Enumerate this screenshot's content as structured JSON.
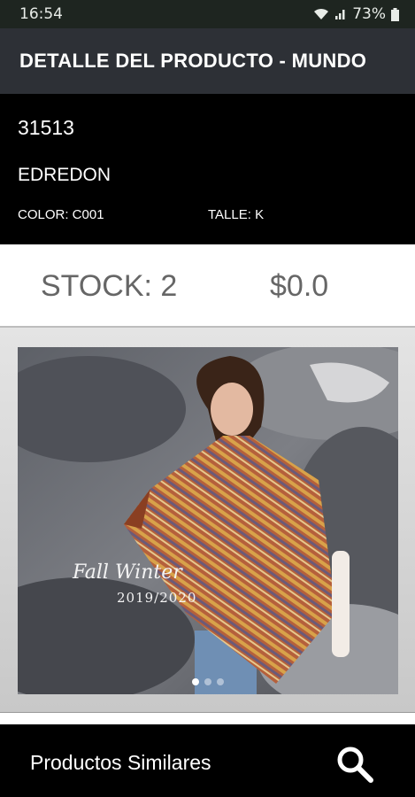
{
  "status_bar": {
    "time": "16:54",
    "battery": "73%",
    "icons": [
      "wifi-icon",
      "signal-icon",
      "battery-icon"
    ]
  },
  "app_bar": {
    "title": "DETALLE DEL PRODUCTO - MUNDO"
  },
  "product": {
    "code": "31513",
    "name": "EDREDON",
    "color": "COLOR: C001",
    "size": "TALLE: K",
    "stock": "STOCK: 2",
    "price": "$0.0"
  },
  "gallery": {
    "caption_line1": "Fall Winter",
    "caption_line2": "2019/2020",
    "page_count": 3,
    "active_page": 1
  },
  "bottom_bar": {
    "label": "Productos Similares",
    "icon": "search-icon"
  }
}
